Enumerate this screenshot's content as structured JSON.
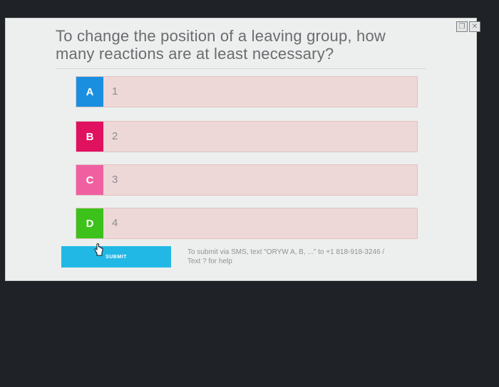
{
  "question": {
    "text": "To change the position of a leaving group, how many reactions are at least necessary?"
  },
  "options": [
    {
      "letter": "A",
      "label": "1"
    },
    {
      "letter": "B",
      "label": "2"
    },
    {
      "letter": "C",
      "label": "3"
    },
    {
      "letter": "D",
      "label": "4"
    }
  ],
  "submit": {
    "label": "SUBMIT"
  },
  "sms": {
    "line1": "To submit via SMS, text \"ORYW A, B, ...\" to +1 818-918-3246 /",
    "line2": "Text ? for help"
  },
  "colors": {
    "accent": "#22b8e6",
    "badge_a": "#1a8fe0",
    "badge_b": "#e0115f",
    "badge_c": "#f060a0",
    "badge_d": "#3cc21a"
  },
  "icons": {
    "cursor": "hand-pointer-icon",
    "restore": "window-restore-icon",
    "close": "close-icon"
  }
}
